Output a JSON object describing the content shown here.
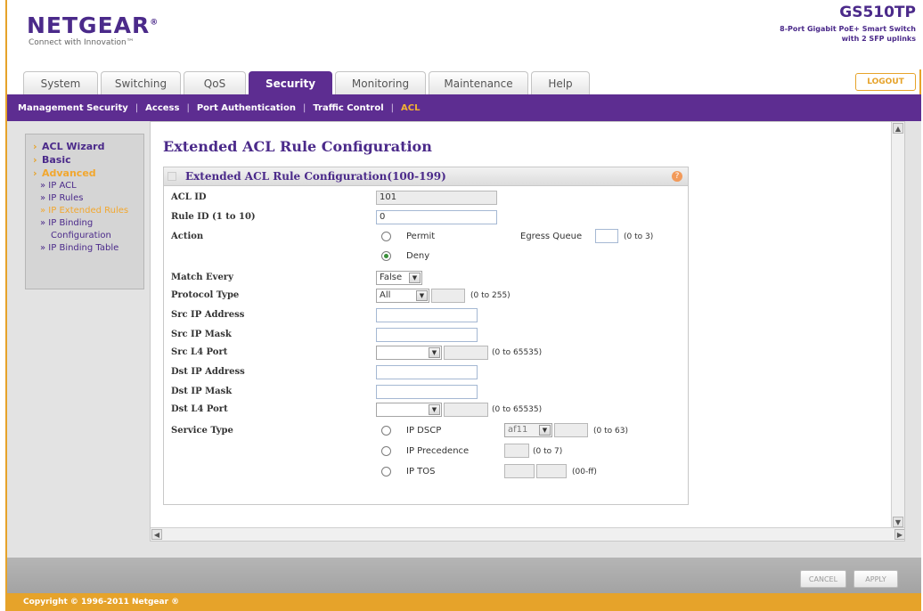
{
  "header": {
    "logo": "NETGEAR",
    "tagline": "Connect with Innovation™",
    "product_name": "GS510TP",
    "product_desc_1": "8-Port Gigabit PoE+ Smart Switch",
    "product_desc_2": "with 2 SFP uplinks"
  },
  "tabs": [
    {
      "label": "System"
    },
    {
      "label": "Switching"
    },
    {
      "label": "QoS"
    },
    {
      "label": "Security"
    },
    {
      "label": "Monitoring"
    },
    {
      "label": "Maintenance"
    },
    {
      "label": "Help"
    }
  ],
  "logout_label": "LOGOUT",
  "subnav": [
    {
      "label": "Management Security"
    },
    {
      "label": "Access"
    },
    {
      "label": "Port Authentication"
    },
    {
      "label": "Traffic Control"
    },
    {
      "label": "ACL"
    }
  ],
  "sidebar": {
    "acl_wizard": "ACL Wizard",
    "basic": "Basic",
    "advanced": "Advanced",
    "ip_acl": "» IP ACL",
    "ip_rules": "» IP Rules",
    "ip_extended_rules": "» IP Extended Rules",
    "ip_binding_config_1": "» IP Binding",
    "ip_binding_config_2": "Configuration",
    "ip_binding_table": "» IP Binding Table"
  },
  "page_title": "Extended ACL Rule Configuration",
  "panel": {
    "title": "Extended ACL Rule Configuration(100-199)",
    "help": "?"
  },
  "form": {
    "acl_id_label": "ACL ID",
    "acl_id_value": "101",
    "rule_id_label": "Rule ID (1 to 10)",
    "rule_id_value": "0",
    "action_label": "Action",
    "permit_label": "Permit",
    "deny_label": "Deny",
    "egress_queue_label": "Egress Queue",
    "egress_queue_value": "",
    "egress_queue_hint": "(0 to 3)",
    "match_every_label": "Match Every",
    "match_every_value": "False",
    "protocol_type_label": "Protocol Type",
    "protocol_type_value": "All",
    "protocol_hint": "(0 to 255)",
    "src_ip_label": "Src IP Address",
    "src_mask_label": "Src IP Mask",
    "src_l4_label": "Src L4 Port",
    "src_l4_hint": "(0 to 65535)",
    "dst_ip_label": "Dst IP Address",
    "dst_mask_label": "Dst IP Mask",
    "dst_l4_label": "Dst L4 Port",
    "dst_l4_hint": "(0 to 65535)",
    "service_type_label": "Service Type",
    "ip_dscp_label": "IP DSCP",
    "dscp_select_value": "af11",
    "dscp_hint": "(0 to 63)",
    "ip_precedence_label": "IP Precedence",
    "precedence_hint": "(0 to 7)",
    "ip_tos_label": "IP TOS",
    "tos_hint": "(00-ff)"
  },
  "buttons": {
    "cancel": "CANCEL",
    "apply": "APPLY"
  },
  "copyright": "Copyright © 1996-2011 Netgear ®"
}
